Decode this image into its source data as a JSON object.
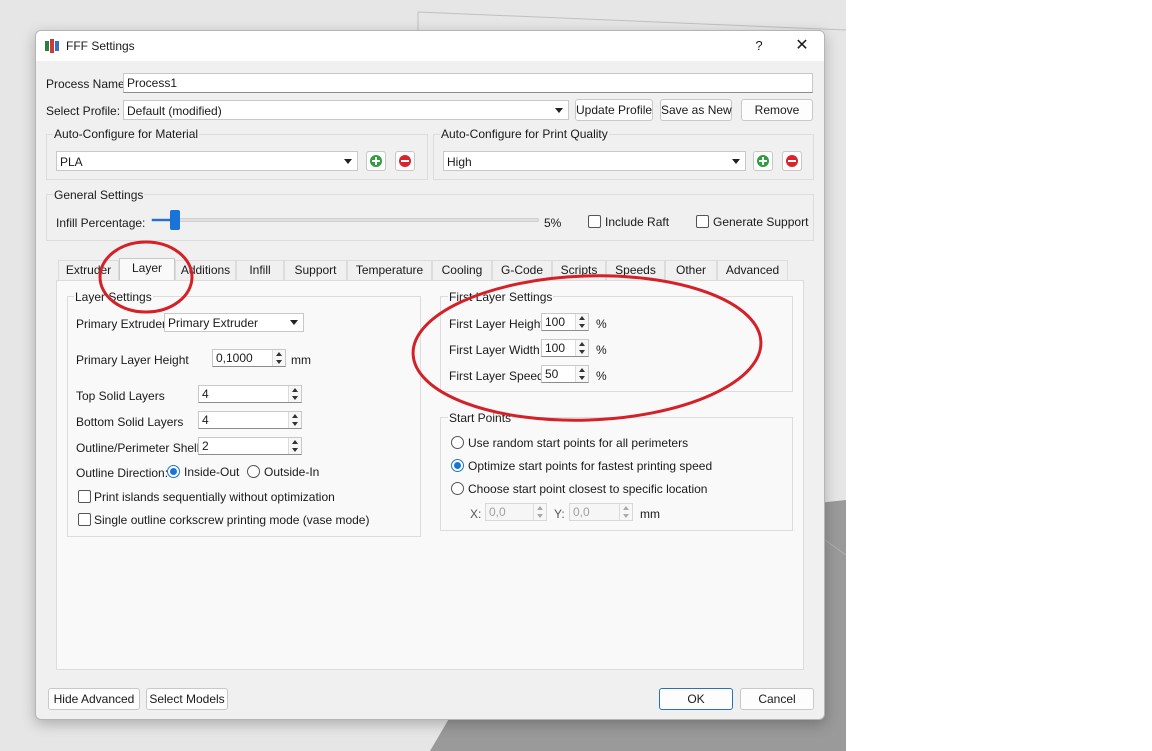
{
  "window": {
    "title": "FFF Settings",
    "help_glyph": "?",
    "close_glyph": "✕"
  },
  "process": {
    "name_label": "Process Name:",
    "name_value": "Process1"
  },
  "profile": {
    "label": "Select Profile:",
    "value": "Default (modified)",
    "update_label": "Update Profile",
    "save_new_label": "Save as New",
    "remove_label": "Remove"
  },
  "material": {
    "group_title": "Auto-Configure for Material",
    "value": "PLA"
  },
  "quality": {
    "group_title": "Auto-Configure for Print Quality",
    "value": "High"
  },
  "general": {
    "group_title": "General Settings",
    "infill_label": "Infill Percentage:",
    "infill_value_text": "5%",
    "infill_fraction": 0.05,
    "raft_label": "Include Raft",
    "support_label": "Generate Support"
  },
  "tabs": [
    {
      "label": "Extruder"
    },
    {
      "label": "Layer"
    },
    {
      "label": "Additions"
    },
    {
      "label": "Infill"
    },
    {
      "label": "Support"
    },
    {
      "label": "Temperature"
    },
    {
      "label": "Cooling"
    },
    {
      "label": "G-Code"
    },
    {
      "label": "Scripts"
    },
    {
      "label": "Speeds"
    },
    {
      "label": "Other"
    },
    {
      "label": "Advanced"
    }
  ],
  "active_tab": "Layer",
  "layer_settings": {
    "group_title": "Layer Settings",
    "primary_extruder_label": "Primary Extruder",
    "primary_extruder_value": "Primary Extruder",
    "layer_height_label": "Primary Layer Height",
    "layer_height_value": "0,1000",
    "layer_height_unit": "mm",
    "top_solid_label": "Top Solid Layers",
    "top_solid_value": "4",
    "bottom_solid_label": "Bottom Solid Layers",
    "bottom_solid_value": "4",
    "shells_label": "Outline/Perimeter Shells",
    "shells_value": "2",
    "direction_label": "Outline Direction:",
    "inside_out_label": "Inside-Out",
    "outside_in_label": "Outside-In",
    "print_islands_label": "Print islands sequentially without optimization",
    "vase_mode_label": "Single outline corkscrew printing mode (vase mode)"
  },
  "first_layer": {
    "group_title": "First Layer Settings",
    "height_label": "First Layer Height",
    "height_value": "100",
    "width_label": "First Layer Width",
    "width_value": "100",
    "speed_label": "First Layer Speed",
    "speed_value": "50",
    "unit": "%"
  },
  "start_points": {
    "group_title": "Start Points",
    "random_label": "Use random start points for all perimeters",
    "optimize_label": "Optimize start points for fastest printing speed",
    "closest_label": "Choose start point closest to specific location",
    "x_label": "X:",
    "x_value": "0,0",
    "y_label": "Y:",
    "y_value": "0,0",
    "unit": "mm"
  },
  "footer": {
    "hide_advanced_label": "Hide Advanced",
    "select_models_label": "Select Models",
    "ok_label": "OK",
    "cancel_label": "Cancel"
  },
  "colors": {
    "accent": "#1a73d9",
    "annotation_red": "#d42027",
    "add_green": "#2e9e3e",
    "remove_red": "#d8232a"
  },
  "icons": [
    "help-icon",
    "close-icon",
    "add-icon",
    "remove-icon",
    "dropdown-arrow-icon",
    "spin-arrows-icon"
  ]
}
